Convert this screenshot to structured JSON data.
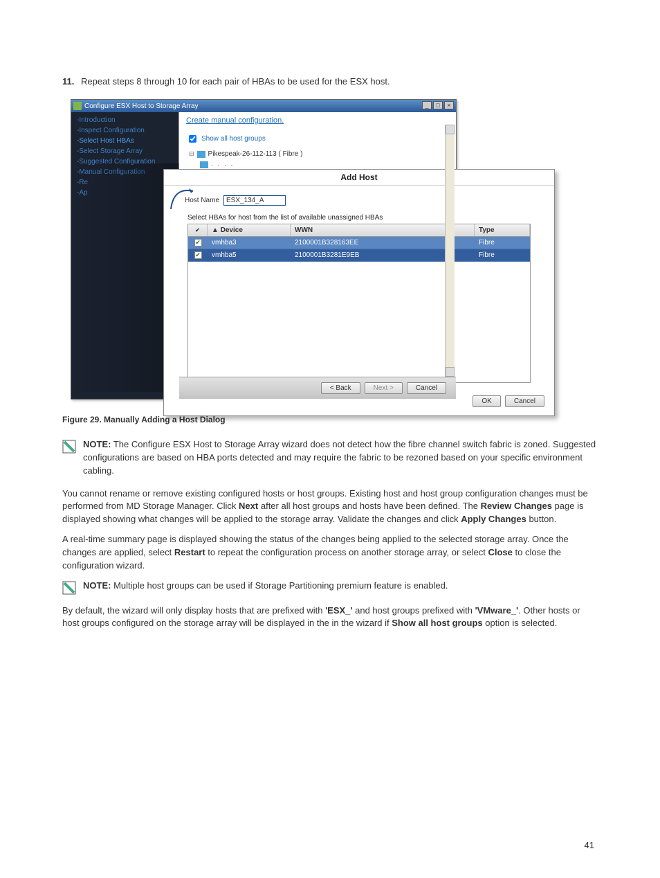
{
  "step_number": "11.",
  "step_text": "Repeat steps 8 through 10 for each pair of HBAs to be used for the ESX host.",
  "window": {
    "title": "Configure ESX Host to Storage Array",
    "nav": [
      "-Introduction",
      "-Inspect Configuration",
      "-Select Host HBAs",
      "-Select Storage Array",
      "-Suggested Configuration",
      "-Manual Configuration",
      "-Re",
      "-Ap"
    ],
    "manual_link": "Create manual configuration.",
    "show_all_label": "Show all host groups",
    "tree": {
      "hostgroup": "Pikespeak-26-112-113 ( Fibre )"
    },
    "footer": {
      "back": "< Back",
      "next": "Next >",
      "cancel": "Cancel"
    }
  },
  "add_host": {
    "title": "Add Host",
    "host_name_label": "Host Name",
    "host_name_value": "ESX_134_A",
    "select_label": "Select HBAs for host from the list of available unassigned HBAs",
    "columns": {
      "device": "Device",
      "wwn": "WWN",
      "type": "Type",
      "sort_marker": "▲"
    },
    "rows": [
      {
        "device": "vmhba3",
        "wwn": "2100001B328163EE",
        "type": "Fibre"
      },
      {
        "device": "vmhba5",
        "wwn": "2100001B3281E9EB",
        "type": "Fibre"
      }
    ],
    "ok": "OK",
    "cancel": "Cancel"
  },
  "figure_caption": "Figure 29. Manually Adding a Host Dialog",
  "note1_label": "NOTE:",
  "note1_text": " The Configure ESX Host to Storage Array wizard does not detect how the fibre channel switch fabric is zoned. Suggested configurations are based on HBA ports detected and may require the fabric to be rezoned based on your specific environment cabling.",
  "para1": {
    "a": "You cannot rename or remove existing configured hosts or host groups. Existing host and host group configuration changes must be performed from MD Storage Manager. Click ",
    "b": "Next",
    "c": " after all host groups and hosts have been defined. The ",
    "d": "Review Changes",
    "e": " page is displayed showing what changes will be applied to the storage array. Validate the changes and click ",
    "f": "Apply Changes",
    "g": " button."
  },
  "para2": {
    "a": "A real-time summary page is displayed showing the status of the changes being applied to the selected storage array. Once the changes are applied, select ",
    "b": "Restart",
    "c": " to repeat the configuration process on another storage array, or select ",
    "d": "Close",
    "e": " to close the configuration wizard."
  },
  "note2_label": "NOTE:",
  "note2_text": " Multiple host groups can be used if Storage Partitioning premium feature is enabled.",
  "para3": {
    "a": "By default, the wizard will only display hosts that are prefixed with ",
    "b": "'ESX_'",
    "c": " and host groups prefixed with ",
    "d": "'VMware_'",
    "e": ". Other hosts or host groups configured on the storage array will be displayed in the in the wizard if ",
    "f": "Show all host groups",
    "g": " option is selected."
  },
  "page_number": "41"
}
